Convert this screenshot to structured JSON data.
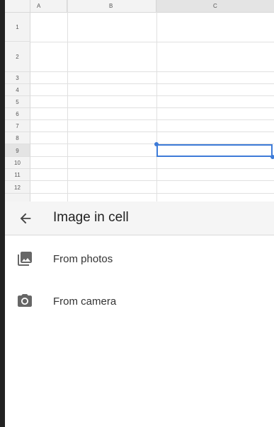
{
  "sheet": {
    "columns": [
      "A",
      "B",
      "C"
    ],
    "rows": [
      "1",
      "2",
      "3",
      "4",
      "5",
      "6",
      "7",
      "8",
      "9",
      "10",
      "11",
      "12"
    ],
    "selected_cell": "C9",
    "accent": "#3d7bd8"
  },
  "panel": {
    "title": "Image in cell",
    "back_icon": "arrow-left-icon",
    "items": [
      {
        "label": "From photos",
        "icon": "photo-library-icon"
      },
      {
        "label": "From camera",
        "icon": "camera-icon"
      }
    ]
  }
}
